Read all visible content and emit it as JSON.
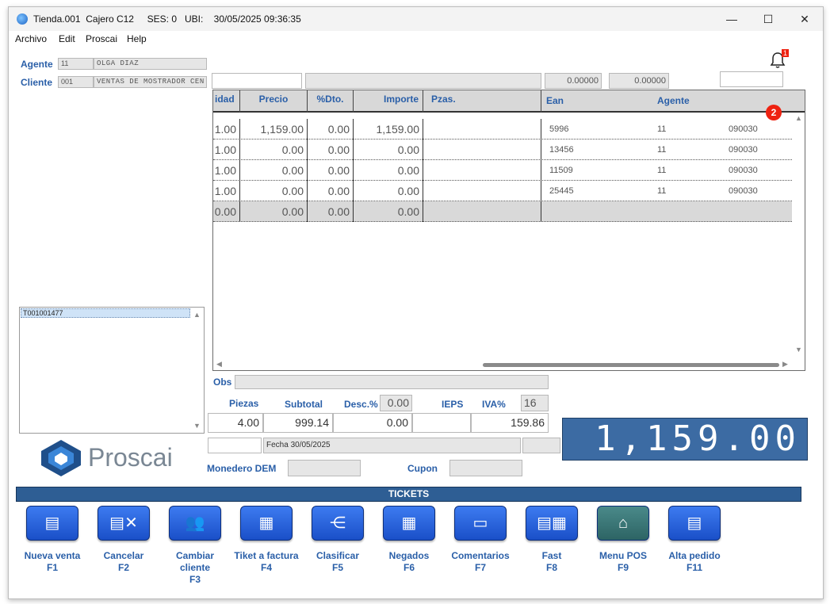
{
  "window": {
    "title": "Tienda.001  Cajero C12     SES: 0   UBI:    30/05/2025 09:36:35",
    "minimize": "—",
    "maximize": "☐",
    "close": "✕"
  },
  "menu": [
    "Archivo",
    "Edit",
    "Proscai",
    "Help"
  ],
  "agente": {
    "label": "Agente",
    "code": "11",
    "name": "OLGA DIAZ"
  },
  "cliente": {
    "label": "Cliente",
    "code": "001",
    "name": "VENTAS DE MOSTRADOR CEN"
  },
  "top_fields": {
    "f1": "",
    "f2": "",
    "v1": "0.00000",
    "v2": "0.00000",
    "f3": ""
  },
  "notifications": {
    "bell_badge": "1",
    "red_badge": "2"
  },
  "grid": {
    "headers": {
      "cantidad": "idad",
      "precio": "Precio",
      "dto": "%Dto.",
      "importe": "Importe",
      "pzas": "Pzas.",
      "ean": "Ean",
      "agente": "Agente"
    },
    "rows": [
      {
        "cantidad": "1.00",
        "precio": "1,159.00",
        "dto": "0.00",
        "importe": "1,159.00",
        "pzas": "",
        "ean": "5996",
        "agente": "11",
        "extra": "090030"
      },
      {
        "cantidad": "1.00",
        "precio": "0.00",
        "dto": "0.00",
        "importe": "0.00",
        "pzas": "",
        "ean": "13456",
        "agente": "11",
        "extra": "090030"
      },
      {
        "cantidad": "1.00",
        "precio": "0.00",
        "dto": "0.00",
        "importe": "0.00",
        "pzas": "",
        "ean": "11509",
        "agente": "11",
        "extra": "090030"
      },
      {
        "cantidad": "1.00",
        "precio": "0.00",
        "dto": "0.00",
        "importe": "0.00",
        "pzas": "",
        "ean": "25445",
        "agente": "11",
        "extra": "090030"
      },
      {
        "cantidad": "0.00",
        "precio": "0.00",
        "dto": "0.00",
        "importe": "0.00",
        "pzas": "",
        "ean": "",
        "agente": "",
        "extra": ""
      }
    ]
  },
  "ticket_list": {
    "items": [
      "T001001477"
    ]
  },
  "obs": {
    "label": "Obs",
    "value": ""
  },
  "totals": {
    "piezas_label": "Piezas",
    "piezas": "4.00",
    "subtotal_label": "Subtotal",
    "subtotal": "999.14",
    "desc_label": "Desc.%",
    "desc_pct": "0.00",
    "desc": "0.00",
    "ieps_label": "IEPS",
    "ieps": "",
    "iva_label": "IVA%",
    "iva_pct": "16",
    "iva": "159.86"
  },
  "fecha": "Fecha 30/05/2025",
  "monedero": {
    "label": "Monedero DEM",
    "value": ""
  },
  "cupon": {
    "label": "Cupon",
    "value": ""
  },
  "total_display": "1,159.00",
  "brand": {
    "name": "Proscai"
  },
  "tickets_bar": "TICKETS",
  "function_buttons": [
    {
      "label": "Nueva venta",
      "key": "F1",
      "icon": "new-sale-icon"
    },
    {
      "label": "Cancelar",
      "key": "F2",
      "icon": "cancel-icon"
    },
    {
      "label": "Cambiar cliente",
      "key": "F3",
      "icon": "users-icon"
    },
    {
      "label": "Tiket a factura",
      "key": "F4",
      "icon": "invoice-icon"
    },
    {
      "label": "Clasificar",
      "key": "F5",
      "icon": "classify-icon"
    },
    {
      "label": "Negados",
      "key": "F6",
      "icon": "grid-icon"
    },
    {
      "label": "Comentarios",
      "key": "F7",
      "icon": "comments-icon"
    },
    {
      "label": "Fast",
      "key": "F8",
      "icon": "fast-icon"
    },
    {
      "label": "Menu POS",
      "key": "F9",
      "icon": "home-icon"
    },
    {
      "label": "Alta pedido",
      "key": "F11",
      "icon": "new-order-icon"
    }
  ]
}
